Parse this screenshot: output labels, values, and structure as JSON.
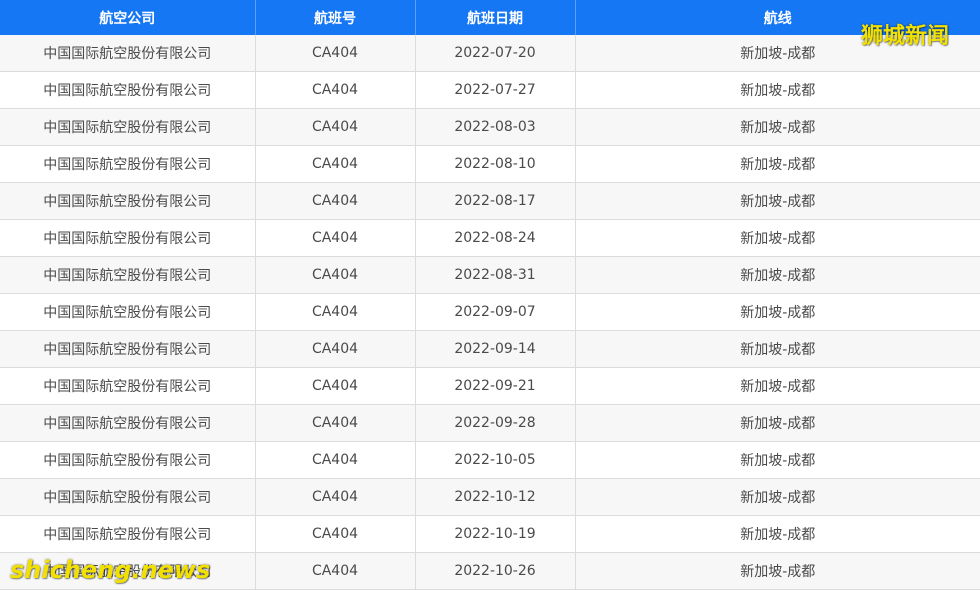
{
  "table": {
    "headers": [
      "航空公司",
      "航班号",
      "航班日期",
      "航线"
    ],
    "rows": [
      [
        "中国国际航空股份有限公司",
        "CA404",
        "2022-07-20",
        "新加坡-成都"
      ],
      [
        "中国国际航空股份有限公司",
        "CA404",
        "2022-07-27",
        "新加坡-成都"
      ],
      [
        "中国国际航空股份有限公司",
        "CA404",
        "2022-08-03",
        "新加坡-成都"
      ],
      [
        "中国国际航空股份有限公司",
        "CA404",
        "2022-08-10",
        "新加坡-成都"
      ],
      [
        "中国国际航空股份有限公司",
        "CA404",
        "2022-08-17",
        "新加坡-成都"
      ],
      [
        "中国国际航空股份有限公司",
        "CA404",
        "2022-08-24",
        "新加坡-成都"
      ],
      [
        "中国国际航空股份有限公司",
        "CA404",
        "2022-08-31",
        "新加坡-成都"
      ],
      [
        "中国国际航空股份有限公司",
        "CA404",
        "2022-09-07",
        "新加坡-成都"
      ],
      [
        "中国国际航空股份有限公司",
        "CA404",
        "2022-09-14",
        "新加坡-成都"
      ],
      [
        "中国国际航空股份有限公司",
        "CA404",
        "2022-09-21",
        "新加坡-成都"
      ],
      [
        "中国国际航空股份有限公司",
        "CA404",
        "2022-09-28",
        "新加坡-成都"
      ],
      [
        "中国国际航空股份有限公司",
        "CA404",
        "2022-10-05",
        "新加坡-成都"
      ],
      [
        "中国国际航空股份有限公司",
        "CA404",
        "2022-10-12",
        "新加坡-成都"
      ],
      [
        "中国国际航空股份有限公司",
        "CA404",
        "2022-10-19",
        "新加坡-成都"
      ],
      [
        "中国国际航空股份有限公司",
        "CA404",
        "2022-10-26",
        "新加坡-成都"
      ]
    ]
  },
  "watermarks": {
    "top_right": "狮城新闻",
    "bottom_left": "shicheng.news"
  },
  "colors": {
    "header_bg": "#1677f5",
    "watermark": "#f2e000"
  }
}
